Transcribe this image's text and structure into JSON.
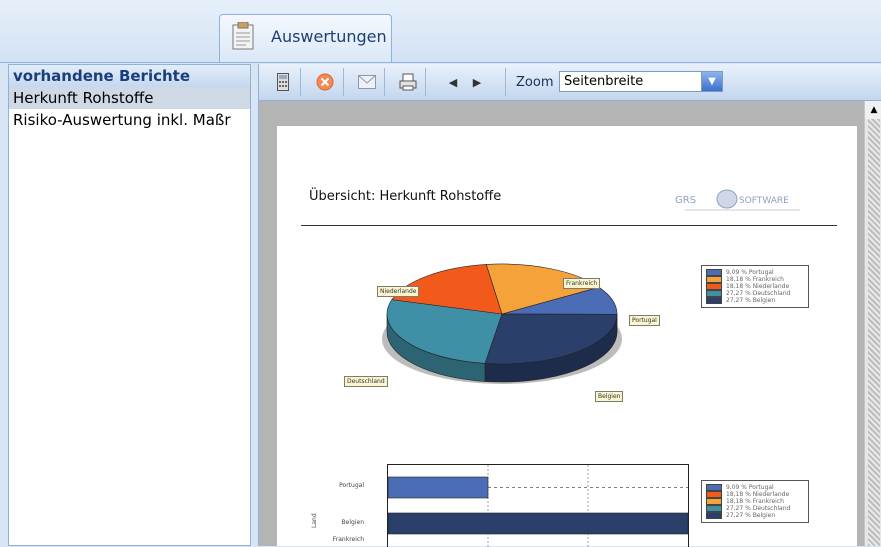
{
  "tab": {
    "label": "Auswertungen"
  },
  "left_panel": {
    "title": "vorhandene Berichte",
    "items": [
      {
        "label": "Herkunft Rohstoffe",
        "selected": true
      },
      {
        "label": "Risiko-Auswertung inkl. Maßr",
        "selected": false
      }
    ]
  },
  "toolbar": {
    "zoom_label": "Zoom",
    "zoom_value": "Seitenbreite"
  },
  "report": {
    "title": "Übersicht: Herkunft Rohstoffe",
    "logo_text": "GRS SOFTWARE",
    "pie_labels": [
      "Niederlande",
      "Frankreich",
      "Portugal",
      "Deutschland",
      "Belgien"
    ],
    "pie_legend": [
      "9,09 % Portugal",
      "18,18 % Frankreich",
      "18,18 % Niederlande",
      "27,27 % Deutschland",
      "27,27 % Belgien"
    ],
    "bar_legend": [
      "9,09 % Portugal",
      "18,18 % Niederlande",
      "18,18 % Frankreich",
      "27,27 % Deutschland",
      "27,27 % Belgien"
    ],
    "bar_labels": [
      "Portugal",
      "Belgien",
      "Frankreich"
    ],
    "bar_axis_label": "Land"
  },
  "chart_data": [
    {
      "type": "pie",
      "categories": [
        "Portugal",
        "Frankreich",
        "Niederlande",
        "Deutschland",
        "Belgien"
      ],
      "values": [
        9.09,
        18.18,
        18.18,
        27.27,
        27.27
      ],
      "colors": [
        "#4a6db5",
        "#f5a23a",
        "#f25a1b",
        "#3f8fa6",
        "#2b3f6b"
      ]
    },
    {
      "type": "bar",
      "categories": [
        "Portugal",
        "Belgien",
        "Frankreich"
      ],
      "values": [
        9.09,
        27.27,
        18.18
      ],
      "colors": [
        "#4a6db5",
        "#2b3f6b",
        "#f25a1b"
      ]
    }
  ],
  "colors": {
    "Portugal": "#4a6db5",
    "Frankreich": "#f5a23a",
    "Niederlande": "#f25a1b",
    "Deutschland": "#3f8fa6",
    "Belgien": "#2b3f6b",
    "accent": "#1b3e7a"
  }
}
